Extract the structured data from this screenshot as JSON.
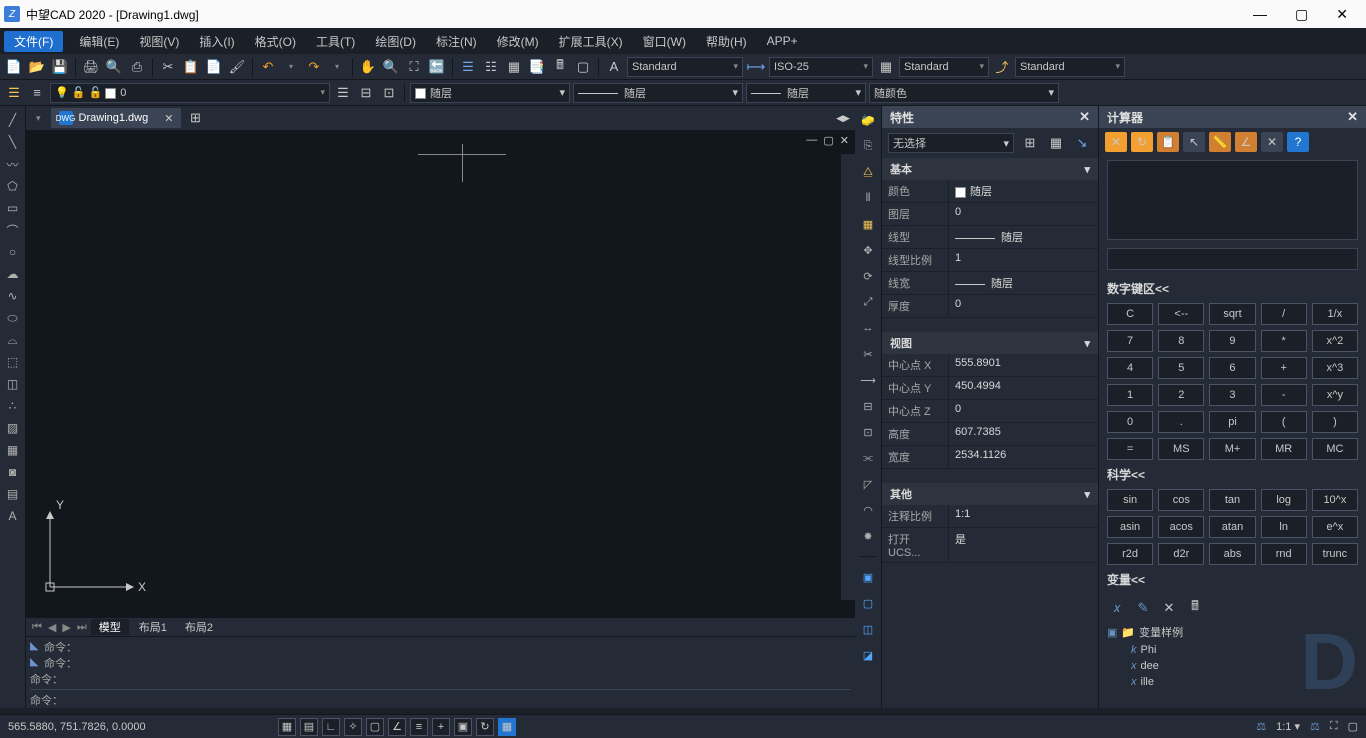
{
  "title": "中望CAD 2020 - [Drawing1.dwg]",
  "menu": {
    "file": "文件(F)",
    "edit": "编辑(E)",
    "view": "视图(V)",
    "insert": "插入(I)",
    "format": "格式(O)",
    "tools": "工具(T)",
    "draw": "绘图(D)",
    "dim": "标注(N)",
    "modify": "修改(M)",
    "ext": "扩展工具(X)",
    "window": "窗口(W)",
    "help": "帮助(H)",
    "app": "APP+"
  },
  "styles": {
    "text": "Standard",
    "dim": "ISO-25",
    "table": "Standard",
    "mleader": "Standard"
  },
  "layer": {
    "current": "0",
    "color": "随层",
    "ltype": "随层",
    "lweight": "随层",
    "colorsel": "随颜色"
  },
  "doc": {
    "name": "Drawing1.dwg"
  },
  "viewtabs": {
    "model": "模型",
    "layout1": "布局1",
    "layout2": "布局2"
  },
  "cmd": {
    "h1": "命令：",
    "h2": "命令：",
    "h3": "命令：",
    "prompt": "命令："
  },
  "status": {
    "coords": "565.5880, 751.7826, 0.0000",
    "scale": "1:1",
    "arrow": "▾"
  },
  "props": {
    "title": "特性",
    "selection": "无选择",
    "sec_basic": "基本",
    "basic": {
      "color_k": "颜色",
      "color_v": "随层",
      "layer_k": "图层",
      "layer_v": "0",
      "ltype_k": "线型",
      "ltype_v": "随层",
      "ltscale_k": "线型比例",
      "ltscale_v": "1",
      "lweight_k": "线宽",
      "lweight_v": "随层",
      "thick_k": "厚度",
      "thick_v": "0"
    },
    "sec_view": "视图",
    "view": {
      "cx_k": "中心点 X",
      "cx_v": "555.8901",
      "cy_k": "中心点 Y",
      "cy_v": "450.4994",
      "cz_k": "中心点 Z",
      "cz_v": "0",
      "h_k": "高度",
      "h_v": "607.7385",
      "w_k": "宽度",
      "w_v": "2534.1126"
    },
    "sec_misc": "其他",
    "misc": {
      "anno_k": "注释比例",
      "anno_v": "1:1",
      "ucs_k": "打开 UCS...",
      "ucs_v": "是"
    }
  },
  "calc": {
    "title": "计算器",
    "sec_num": "数字键区<<",
    "keys_num": [
      "C",
      "<--",
      "sqrt",
      "/",
      "1/x",
      "7",
      "8",
      "9",
      "*",
      "x^2",
      "4",
      "5",
      "6",
      "+",
      "x^3",
      "1",
      "2",
      "3",
      "-",
      "x^y",
      "0",
      ".",
      "pi",
      "(",
      ")",
      "=",
      "MS",
      "M+",
      "MR",
      "MC"
    ],
    "sec_sci": "科学<<",
    "keys_sci": [
      "sin",
      "cos",
      "tan",
      "log",
      "10^x",
      "asin",
      "acos",
      "atan",
      "ln",
      "e^x",
      "r2d",
      "d2r",
      "abs",
      "rnd",
      "trunc"
    ],
    "sec_var": "变量<<",
    "var_root": "变量样例",
    "var1_name": "Phi",
    "var1_sym": "k",
    "var2_name": "dee",
    "var2_sym": "x",
    "var3_name": "ille",
    "var3_sym": "x"
  }
}
